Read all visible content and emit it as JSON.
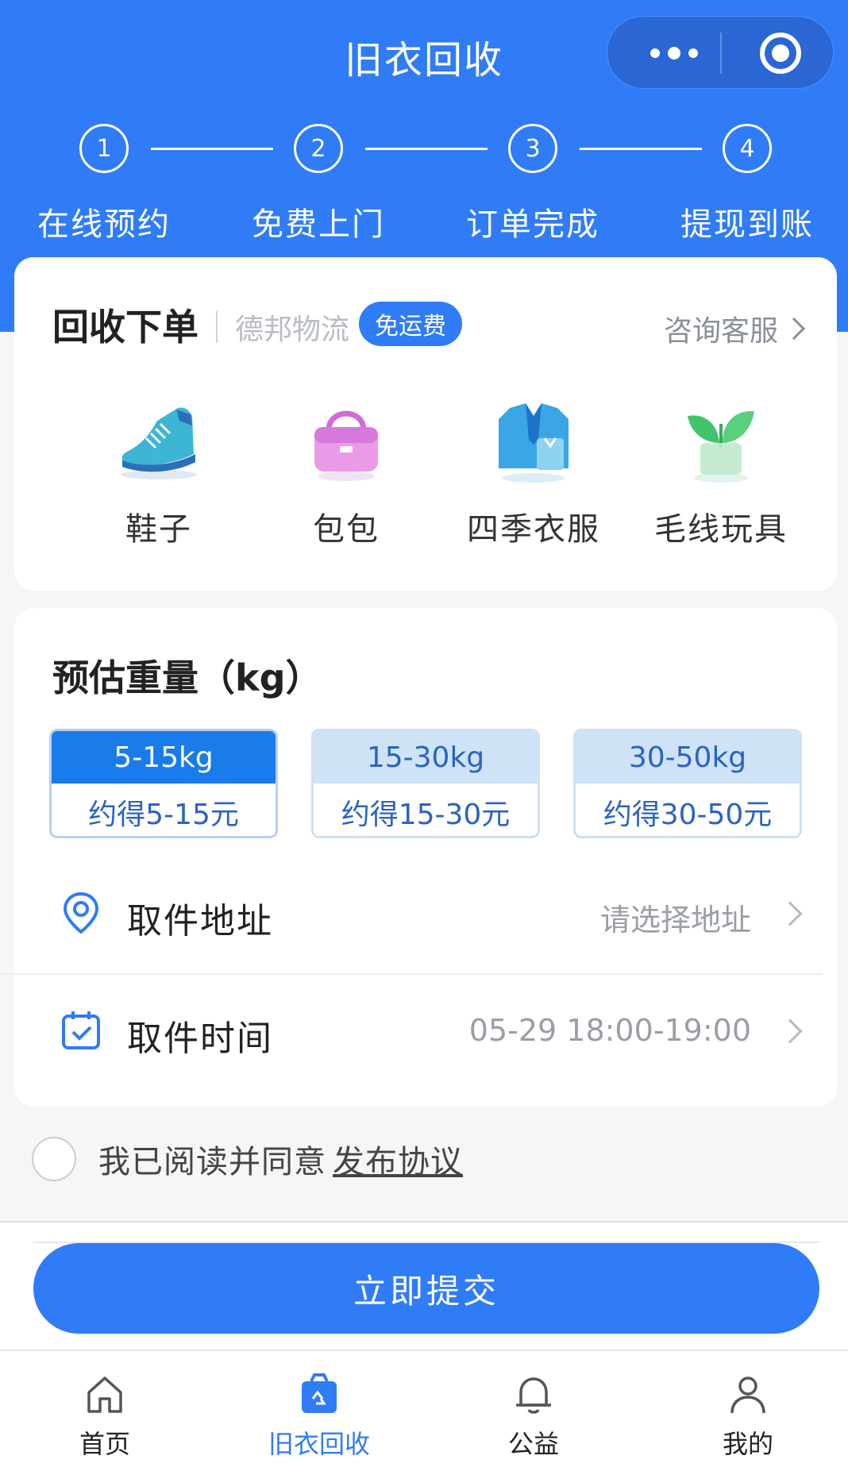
{
  "header": {
    "title": "旧衣回收"
  },
  "steps": [
    {
      "num": "1",
      "label": "在线预约"
    },
    {
      "num": "2",
      "label": "免费上门"
    },
    {
      "num": "3",
      "label": "订单完成"
    },
    {
      "num": "4",
      "label": "提现到账"
    }
  ],
  "order_card": {
    "title": "回收下单",
    "company": "德邦物流",
    "free_badge": "免运费",
    "service_link": "咨询客服",
    "categories": [
      {
        "label": "鞋子",
        "icon": "shoe-icon"
      },
      {
        "label": "包包",
        "icon": "bag-icon"
      },
      {
        "label": "四季衣服",
        "icon": "clothes-icon"
      },
      {
        "label": "毛线玩具",
        "icon": "plant-icon"
      }
    ]
  },
  "weight": {
    "title": "预估重量（kg）",
    "options": [
      {
        "range": "5-15kg",
        "earn": "约得5-15元",
        "selected": true
      },
      {
        "range": "15-30kg",
        "earn": "约得15-30元",
        "selected": false
      },
      {
        "range": "30-50kg",
        "earn": "约得30-50元",
        "selected": false
      }
    ]
  },
  "pickup": {
    "address_label": "取件地址",
    "address_value": "请选择地址",
    "time_label": "取件时间",
    "time_value": "05-29 18:00-19:00"
  },
  "agreement": {
    "text": "我已阅读并同意",
    "link": "发布协议"
  },
  "submit": {
    "label": "立即提交"
  },
  "tabbar": [
    {
      "label": "首页",
      "icon": "home-icon",
      "active": false
    },
    {
      "label": "旧衣回收",
      "icon": "recycle-bag-icon",
      "active": true
    },
    {
      "label": "公益",
      "icon": "bell-icon",
      "active": false
    },
    {
      "label": "我的",
      "icon": "user-icon",
      "active": false
    }
  ],
  "colors": {
    "primary": "#2f7cf6",
    "selected_option": "#1a7bea"
  }
}
